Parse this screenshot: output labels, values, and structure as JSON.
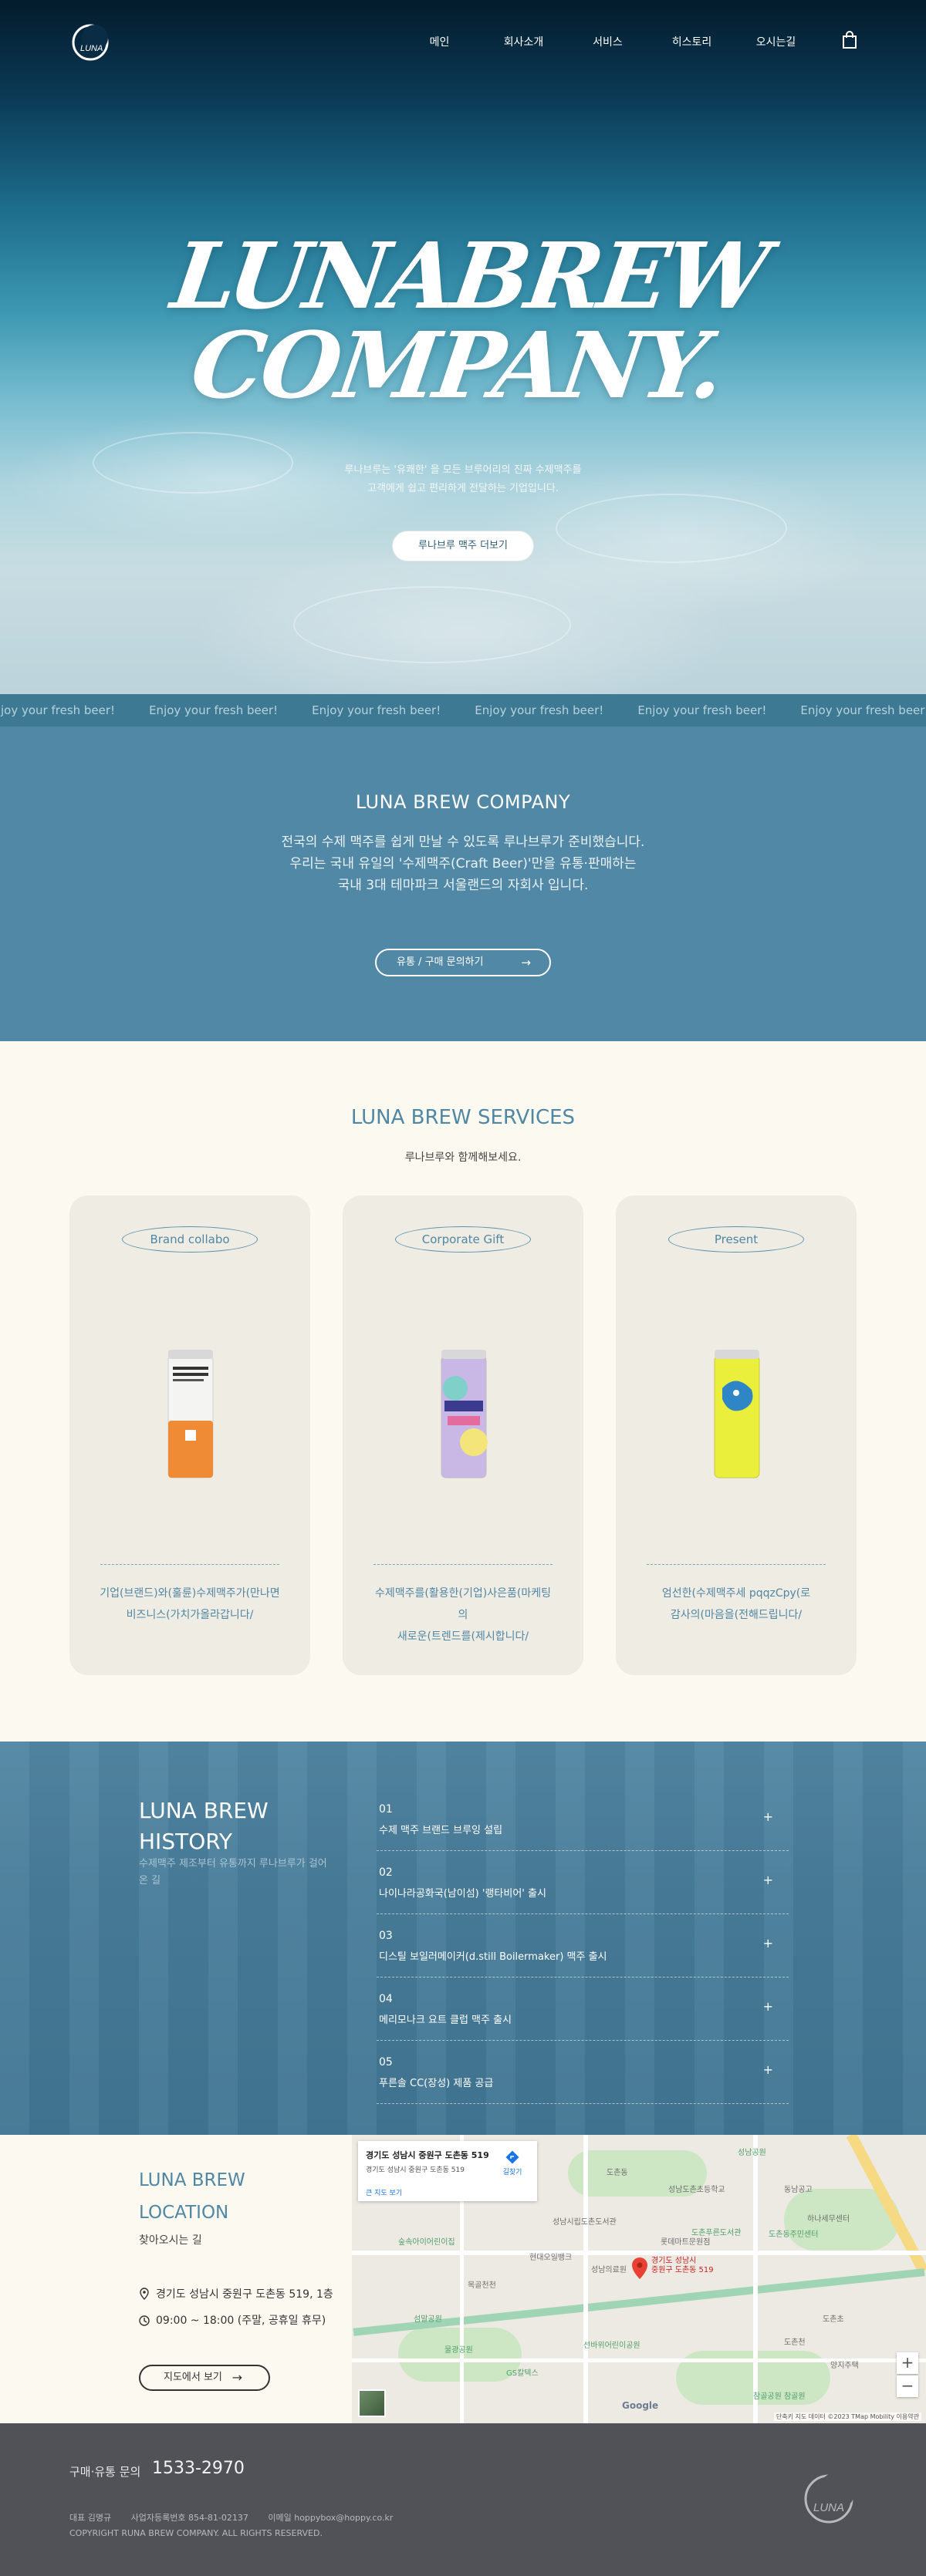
{
  "nav": {
    "menu": [
      "메인",
      "회사소개",
      "서비스",
      "히스토리",
      "오시는길"
    ],
    "cart_icon": "shopping-bag-icon",
    "logo_text": "LUNA"
  },
  "hero": {
    "title_line1": "LUNABREW",
    "title_line2": "COMPANY.",
    "desc_line1": "루나브루는 '유쾌한' 을 모든 브루어리의 진짜 수제맥주를",
    "desc_line2": "고객에게 쉽고 편리하게 전달하는 기업입니다.",
    "button": "루나브루 맥주 더보기"
  },
  "marquee": {
    "text": "Enjoy your fresh beer!",
    "repeat": 7
  },
  "about": {
    "title": "LUNA BREW COMPANY",
    "line1": "전국의 수제 맥주를 쉽게 만날 수 있도록 루나브루가 준비했습니다.",
    "line2": "우리는 국내 유일의 '수제맥주(Craft Beer)'만을 유통·판매하는",
    "line3": "국내 3대 테마파크 서울랜드의 자회사 입니다.",
    "button": "유통 / 구매 문의하기",
    "button_arrow": "→"
  },
  "services": {
    "title": "LUNA BREW SERVICES",
    "subtitle": "루나브루와 함께해보세요.",
    "cards": [
      {
        "label": "Brand collabo",
        "desc1": "기업(브랜드)와(훌륜)수제맥주가(만나면",
        "desc2": "비즈니스(가치가올라갑니다/"
      },
      {
        "label": "Corporate Gift",
        "desc1": "수제맥주를(활용한(기업)사은품(마케팅",
        "desc2": "의",
        "desc3": "새로운(트렌드를(제시합니다/"
      },
      {
        "label": "Present",
        "desc1": "엄선한(수제맥주세 pqqzCpy(로",
        "desc2": "감사의(마음을(전해드립니다/"
      }
    ]
  },
  "history": {
    "title_line1": "LUNA BREW",
    "title_line2": "HISTORY",
    "subtitle": "수제맥주 제조부터 유통까지 루나브루가 걸어온 길",
    "items": [
      {
        "num": "01",
        "text": "수제 맥주 브랜드 브루잉 설립"
      },
      {
        "num": "02",
        "text": "나이나라공화국(남이섬) '랭타비어' 출시"
      },
      {
        "num": "03",
        "text": "디스틸 보일러메이커(d.still Boilermaker) 맥주 출시"
      },
      {
        "num": "04",
        "text": "메리모나크 요트 클럽 맥주 출시"
      },
      {
        "num": "05",
        "text": "푸른솔 CC(장성) 제품 공급"
      }
    ],
    "plus": "+"
  },
  "location": {
    "title_line1": "LUNA BREW",
    "title_line2": "LOCATION",
    "subtitle": "찾아오시는 길",
    "address": "경기도 성남시 중원구 도촌동 519, 1층",
    "hours": "09:00 ~ 18:00 (주말, 공휴일 휴무)",
    "button": "지도에서 보기",
    "button_arrow": "→",
    "map": {
      "info_title": "경기도 성남시 중원구 도촌동 519",
      "info_address": "경기도 성남시 중원구 도촌동 519",
      "info_link": "큰 지도 보기",
      "directions": "길찾기",
      "pin_label1": "경기도 성남시",
      "pin_label2": "중원구 도촌동 519",
      "google": "Google",
      "attribution": "단축키   지도 데이터 ©2023 TMap Mobility   이용약관",
      "labels": [
        "성남공원",
        "도촌동",
        "성남도촌초등학교",
        "동남공고",
        "도촌동주민센터",
        "하나세무센터",
        "롯데마트문원점",
        "도촌푸른도서관",
        "숲속아이어린이집",
        "성남시립도촌도서관",
        "현대오일뱅크",
        "성남의료원",
        "도촌초",
        "목골천천",
        "섬말공원",
        "도촌천",
        "물광공원",
        "선바위어린이공원",
        "참골공원 참골원",
        "양지주택",
        "GS칼텍스"
      ],
      "zoom_in": "+",
      "zoom_out": "−"
    }
  },
  "footer": {
    "contact_label": "구매·유통 문의",
    "phone": "1533-2970",
    "ceo": "대표   김명규",
    "biz_no": "사업자등록번호   854-81-02137",
    "email": "이메일   hoppybox@hoppy.co.kr",
    "copyright": "COPYRIGHT RUNA BREW COMPANY. ALL RIGHTS RESERVED."
  },
  "colors": {
    "primary": "#5188a5",
    "marquee": "#3e7993",
    "cream": "#fcf9f0",
    "card": "#efece4",
    "footer": "#505257"
  }
}
